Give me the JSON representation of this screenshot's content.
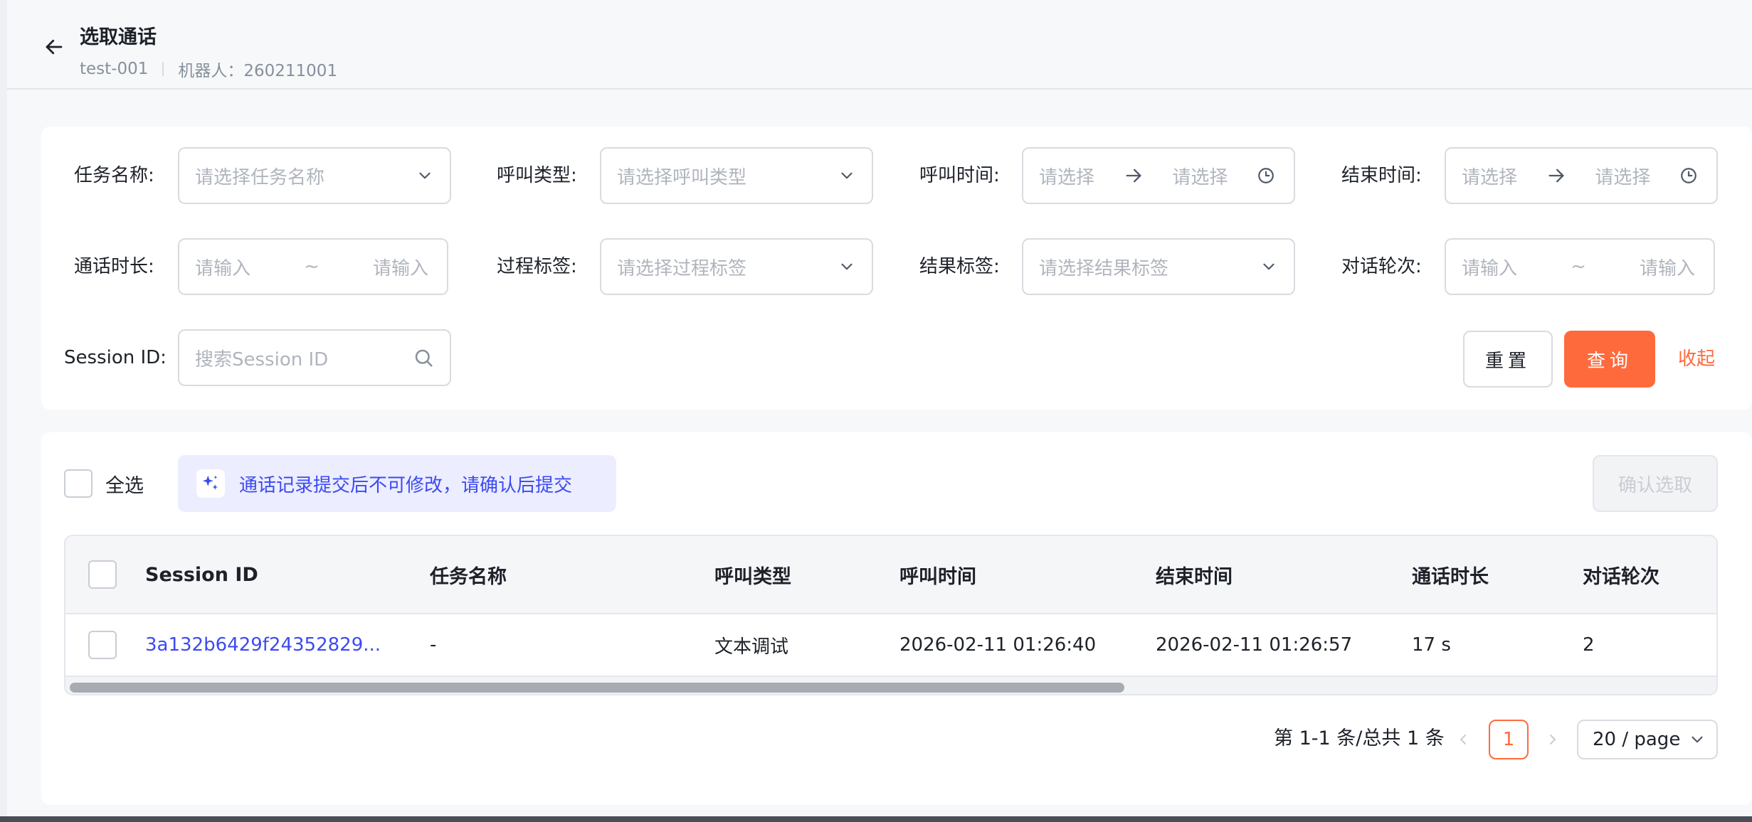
{
  "header": {
    "title": "选取通话",
    "task_code": "test-001",
    "robot": "机器人：260211001"
  },
  "filters": {
    "task_name": {
      "label": "任务名称:",
      "placeholder": "请选择任务名称"
    },
    "call_type": {
      "label": "呼叫类型:",
      "placeholder": "请选择呼叫类型"
    },
    "call_time": {
      "label": "呼叫时间:",
      "start_placeholder": "请选择",
      "end_placeholder": "请选择"
    },
    "end_time": {
      "label": "结束时间:",
      "start_placeholder": "请选择",
      "end_placeholder": "请选择"
    },
    "duration": {
      "label": "通话时长:",
      "min_placeholder": "请输入",
      "separator": "~",
      "max_placeholder": "请输入"
    },
    "process_tag": {
      "label": "过程标签:",
      "placeholder": "请选择过程标签"
    },
    "result_tag": {
      "label": "结果标签:",
      "placeholder": "请选择结果标签"
    },
    "rounds": {
      "label": "对话轮次:",
      "min_placeholder": "请输入",
      "separator": "~",
      "max_placeholder": "请输入"
    },
    "session_id": {
      "label": "Session ID:",
      "placeholder": "搜索Session ID"
    },
    "reset_label": "重置",
    "query_label": "查询",
    "collapse_label": "收起"
  },
  "list": {
    "select_all_label": "全选",
    "notice": "通话记录提交后不可修改，请确认后提交",
    "confirm_label": "确认选取",
    "columns": [
      "Session ID",
      "任务名称",
      "呼叫类型",
      "呼叫时间",
      "结束时间",
      "通话时长",
      "对话轮次"
    ],
    "rows": [
      {
        "session_id": "3a132b6429f24352829...",
        "task_name": "-",
        "call_type": "文本调试",
        "call_time": "2026-02-11 01:26:40",
        "end_time": "2026-02-11 01:26:57",
        "duration": "17 s",
        "rounds": "2"
      }
    ],
    "scroll_position": 0
  },
  "pagination": {
    "total_text": "第 1-1 条/总共 1 条",
    "current_page": "1",
    "page_size": "20 / page"
  },
  "colors": {
    "accent": "#ff6a3d",
    "link": "#3c4bf0",
    "notice_bg": "#ecedff"
  }
}
